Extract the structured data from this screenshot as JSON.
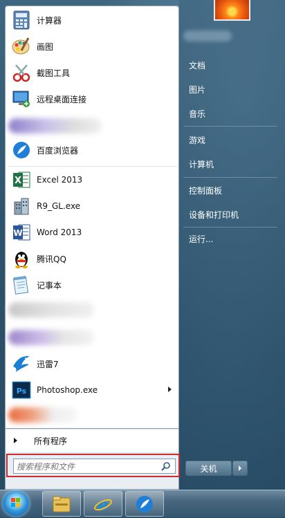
{
  "start_menu": {
    "programs": [
      {
        "label": "计算器",
        "icon": "calculator-icon"
      },
      {
        "label": "画图",
        "icon": "paint-icon"
      },
      {
        "label": "截图工具",
        "icon": "snipping-tool-icon"
      },
      {
        "label": "远程桌面连接",
        "icon": "remote-desktop-icon"
      },
      {
        "label": "百度浏览器",
        "icon": "baidu-browser-icon"
      },
      {
        "label": "Excel 2013",
        "icon": "excel-icon"
      },
      {
        "label": "R9_GL.exe",
        "icon": "building-icon"
      },
      {
        "label": "Word 2013",
        "icon": "word-icon"
      },
      {
        "label": "腾讯QQ",
        "icon": "qq-penguin-icon"
      },
      {
        "label": "记事本",
        "icon": "notepad-icon"
      },
      {
        "label": "迅雷7",
        "icon": "xunlei-bird-icon"
      },
      {
        "label": "Photoshop.exe",
        "icon": "photoshop-icon"
      }
    ],
    "all_programs": "所有程序",
    "search_placeholder": "搜索程序和文件"
  },
  "right_pane": {
    "items": [
      "文档",
      "图片",
      "音乐",
      "游戏",
      "计算机",
      "控制面板",
      "设备和打印机",
      "运行..."
    ],
    "shutdown_label": "关机"
  },
  "taskbar": {
    "items": [
      "file-explorer-icon",
      "internet-explorer-icon",
      "baidu-browser-icon"
    ]
  },
  "colors": {
    "highlight": "#d22a2a",
    "accent": "#2d8fd5"
  }
}
